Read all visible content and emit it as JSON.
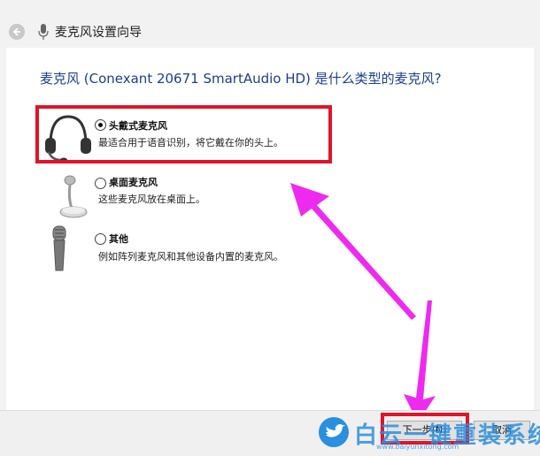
{
  "window": {
    "title": "麦克风设置向导"
  },
  "question": "麦克风 (Conexant 20671 SmartAudio HD) 是什么类型的麦克风?",
  "options": [
    {
      "label": "头戴式麦克风",
      "desc": "最适合用于语音识别，将它戴在你的头上。",
      "selected": true,
      "icon": "headset-icon"
    },
    {
      "label": "桌面麦克风",
      "desc": "这些麦克风放在桌面上。",
      "selected": false,
      "icon": "desktop-mic-icon"
    },
    {
      "label": "其他",
      "desc": "例如阵列麦克风和其他设备内置的麦克风。",
      "selected": false,
      "icon": "handheld-mic-icon"
    }
  ],
  "footer": {
    "next_label": "下一步(N)",
    "cancel_label": "取消"
  },
  "watermark": {
    "text": "白云一键重装系统",
    "url": "www.baiyunxitong.com"
  },
  "colors": {
    "accent": "#1a3f8f",
    "highlight": "#e0142a",
    "arrow": "#ee2af0"
  }
}
